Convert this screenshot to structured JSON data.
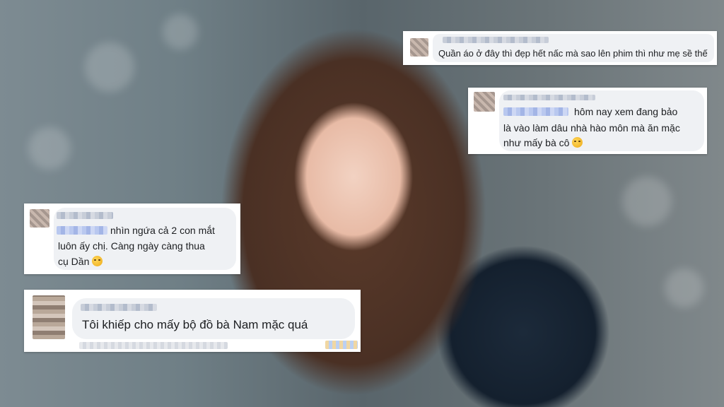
{
  "comments": [
    {
      "text": "Quần áo ở đây thì đẹp hết nấc mà sao lên phim thì như mẹ sề thế"
    },
    {
      "lines": [
        "hôm nay xem đang bảo",
        "là vào làm dâu nhà hào môn mà ăn mặc",
        "như mấy bà cô"
      ]
    },
    {
      "lines": [
        "nhìn ngứa cả 2 con mắt",
        "luôn ấy chị. Càng ngày càng thua",
        "cụ Dần"
      ]
    },
    {
      "text": "Tôi khiếp cho mấy bộ đồ bà Nam mặc quá"
    }
  ],
  "icons": [
    "laughing-emoji-icon"
  ]
}
